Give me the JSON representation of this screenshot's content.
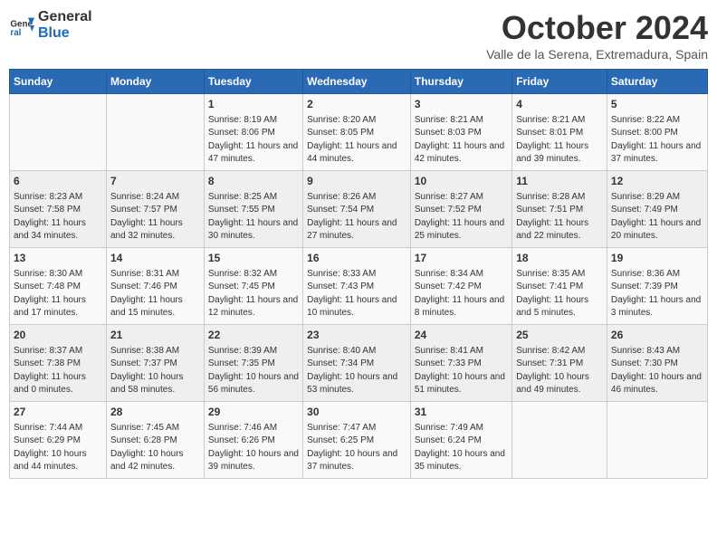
{
  "header": {
    "logo_general": "General",
    "logo_blue": "Blue",
    "month_title": "October 2024",
    "subtitle": "Valle de la Serena, Extremadura, Spain"
  },
  "days_of_week": [
    "Sunday",
    "Monday",
    "Tuesday",
    "Wednesday",
    "Thursday",
    "Friday",
    "Saturday"
  ],
  "weeks": [
    [
      {
        "day": "",
        "info": ""
      },
      {
        "day": "",
        "info": ""
      },
      {
        "day": "1",
        "info": "Sunrise: 8:19 AM\nSunset: 8:06 PM\nDaylight: 11 hours and 47 minutes."
      },
      {
        "day": "2",
        "info": "Sunrise: 8:20 AM\nSunset: 8:05 PM\nDaylight: 11 hours and 44 minutes."
      },
      {
        "day": "3",
        "info": "Sunrise: 8:21 AM\nSunset: 8:03 PM\nDaylight: 11 hours and 42 minutes."
      },
      {
        "day": "4",
        "info": "Sunrise: 8:21 AM\nSunset: 8:01 PM\nDaylight: 11 hours and 39 minutes."
      },
      {
        "day": "5",
        "info": "Sunrise: 8:22 AM\nSunset: 8:00 PM\nDaylight: 11 hours and 37 minutes."
      }
    ],
    [
      {
        "day": "6",
        "info": "Sunrise: 8:23 AM\nSunset: 7:58 PM\nDaylight: 11 hours and 34 minutes."
      },
      {
        "day": "7",
        "info": "Sunrise: 8:24 AM\nSunset: 7:57 PM\nDaylight: 11 hours and 32 minutes."
      },
      {
        "day": "8",
        "info": "Sunrise: 8:25 AM\nSunset: 7:55 PM\nDaylight: 11 hours and 30 minutes."
      },
      {
        "day": "9",
        "info": "Sunrise: 8:26 AM\nSunset: 7:54 PM\nDaylight: 11 hours and 27 minutes."
      },
      {
        "day": "10",
        "info": "Sunrise: 8:27 AM\nSunset: 7:52 PM\nDaylight: 11 hours and 25 minutes."
      },
      {
        "day": "11",
        "info": "Sunrise: 8:28 AM\nSunset: 7:51 PM\nDaylight: 11 hours and 22 minutes."
      },
      {
        "day": "12",
        "info": "Sunrise: 8:29 AM\nSunset: 7:49 PM\nDaylight: 11 hours and 20 minutes."
      }
    ],
    [
      {
        "day": "13",
        "info": "Sunrise: 8:30 AM\nSunset: 7:48 PM\nDaylight: 11 hours and 17 minutes."
      },
      {
        "day": "14",
        "info": "Sunrise: 8:31 AM\nSunset: 7:46 PM\nDaylight: 11 hours and 15 minutes."
      },
      {
        "day": "15",
        "info": "Sunrise: 8:32 AM\nSunset: 7:45 PM\nDaylight: 11 hours and 12 minutes."
      },
      {
        "day": "16",
        "info": "Sunrise: 8:33 AM\nSunset: 7:43 PM\nDaylight: 11 hours and 10 minutes."
      },
      {
        "day": "17",
        "info": "Sunrise: 8:34 AM\nSunset: 7:42 PM\nDaylight: 11 hours and 8 minutes."
      },
      {
        "day": "18",
        "info": "Sunrise: 8:35 AM\nSunset: 7:41 PM\nDaylight: 11 hours and 5 minutes."
      },
      {
        "day": "19",
        "info": "Sunrise: 8:36 AM\nSunset: 7:39 PM\nDaylight: 11 hours and 3 minutes."
      }
    ],
    [
      {
        "day": "20",
        "info": "Sunrise: 8:37 AM\nSunset: 7:38 PM\nDaylight: 11 hours and 0 minutes."
      },
      {
        "day": "21",
        "info": "Sunrise: 8:38 AM\nSunset: 7:37 PM\nDaylight: 10 hours and 58 minutes."
      },
      {
        "day": "22",
        "info": "Sunrise: 8:39 AM\nSunset: 7:35 PM\nDaylight: 10 hours and 56 minutes."
      },
      {
        "day": "23",
        "info": "Sunrise: 8:40 AM\nSunset: 7:34 PM\nDaylight: 10 hours and 53 minutes."
      },
      {
        "day": "24",
        "info": "Sunrise: 8:41 AM\nSunset: 7:33 PM\nDaylight: 10 hours and 51 minutes."
      },
      {
        "day": "25",
        "info": "Sunrise: 8:42 AM\nSunset: 7:31 PM\nDaylight: 10 hours and 49 minutes."
      },
      {
        "day": "26",
        "info": "Sunrise: 8:43 AM\nSunset: 7:30 PM\nDaylight: 10 hours and 46 minutes."
      }
    ],
    [
      {
        "day": "27",
        "info": "Sunrise: 7:44 AM\nSunset: 6:29 PM\nDaylight: 10 hours and 44 minutes."
      },
      {
        "day": "28",
        "info": "Sunrise: 7:45 AM\nSunset: 6:28 PM\nDaylight: 10 hours and 42 minutes."
      },
      {
        "day": "29",
        "info": "Sunrise: 7:46 AM\nSunset: 6:26 PM\nDaylight: 10 hours and 39 minutes."
      },
      {
        "day": "30",
        "info": "Sunrise: 7:47 AM\nSunset: 6:25 PM\nDaylight: 10 hours and 37 minutes."
      },
      {
        "day": "31",
        "info": "Sunrise: 7:49 AM\nSunset: 6:24 PM\nDaylight: 10 hours and 35 minutes."
      },
      {
        "day": "",
        "info": ""
      },
      {
        "day": "",
        "info": ""
      }
    ]
  ]
}
